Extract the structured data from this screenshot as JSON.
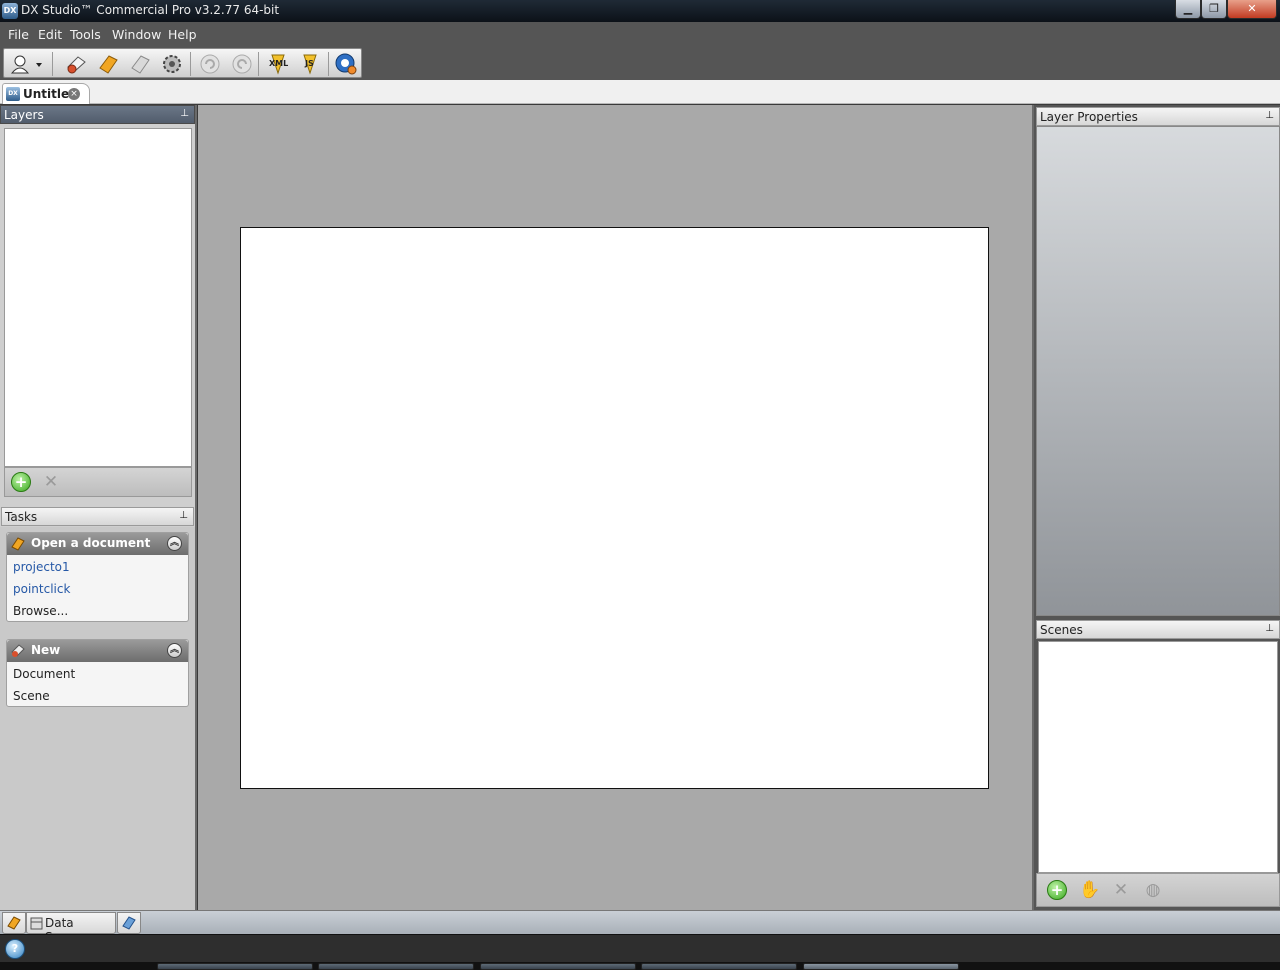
{
  "window": {
    "title": "DX Studio™ Commercial Pro v3.2.77 64-bit",
    "app_icon": "DX",
    "controls": {
      "minimize": "▁",
      "maximize": "❐",
      "close": "✕"
    }
  },
  "menu": [
    "File",
    "Edit",
    "Tools",
    "Window",
    "Help"
  ],
  "toolbar": {
    "icons": [
      "user-dropdown-icon",
      "new-scene-icon",
      "open-document-icon",
      "save-icon",
      "settings-gear-icon",
      "undo-icon",
      "redo-icon",
      "xml-icon",
      "javascript-icon",
      "publish-globe-icon"
    ],
    "xml_label": "XML",
    "js_label": "JS"
  },
  "document_tab": {
    "icon_text": "DX",
    "label": "Untitled",
    "close": "×"
  },
  "layers_panel": {
    "title": "Layers",
    "pin": "📌"
  },
  "tasks_panel": {
    "title": "Tasks",
    "groups": [
      {
        "title": "Open a document",
        "items": [
          "projecto1",
          "pointclick",
          "Browse..."
        ]
      },
      {
        "title": "New",
        "items": [
          "Document",
          "Scene"
        ]
      }
    ],
    "collapse_glyph": "︽"
  },
  "layer_properties_panel": {
    "title": "Layer Properties"
  },
  "scenes_panel": {
    "title": "Scenes"
  },
  "bottom_tabs": {
    "data_sources": "Data Sources"
  },
  "colors": {
    "accent": "#2558a6",
    "chrome": "#555555",
    "canvas_bg": "#a9a9a9"
  }
}
